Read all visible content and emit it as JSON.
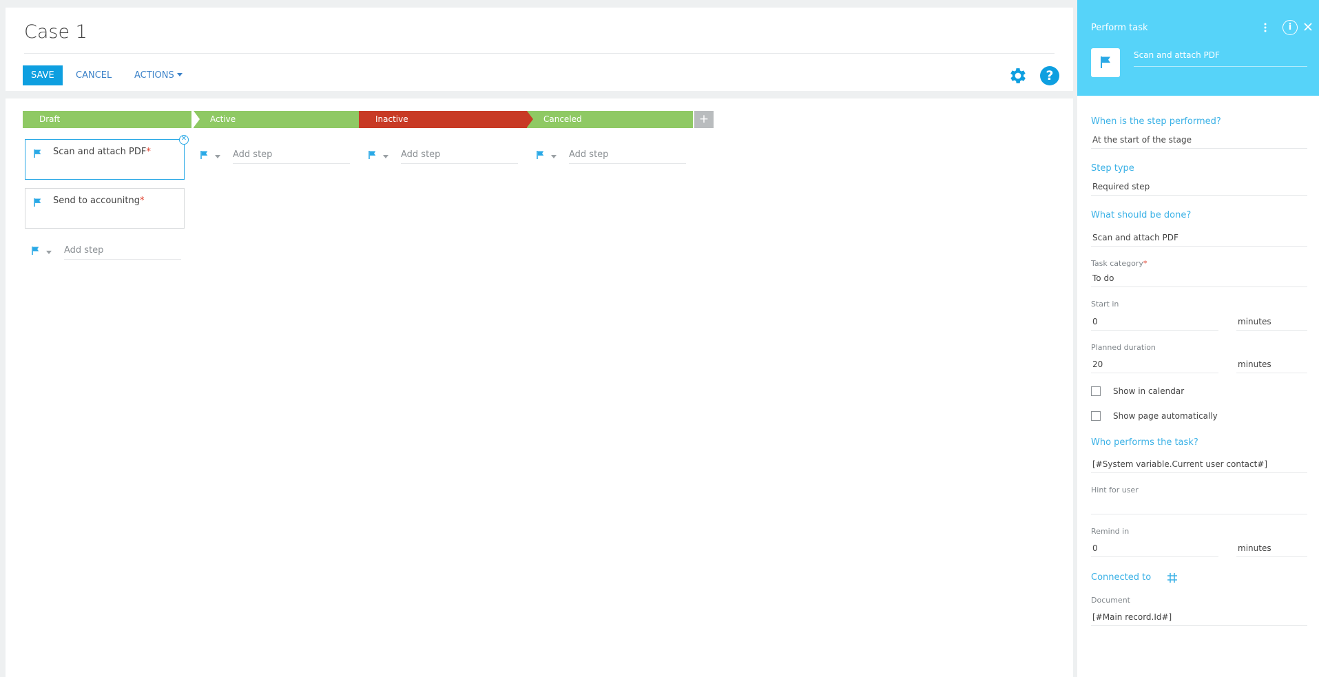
{
  "page": {
    "title": "Case 1",
    "save_label": "SAVE",
    "cancel_label": "CANCEL",
    "actions_label": "ACTIONS"
  },
  "stages": [
    {
      "label": "Draft",
      "color": "#8fc964"
    },
    {
      "label": "Active",
      "color": "#8fc964"
    },
    {
      "label": "Inactive",
      "color": "#c83a25"
    },
    {
      "label": "Canceled",
      "color": "#8fc964"
    }
  ],
  "add_stage_label": "+",
  "steps": [
    {
      "label": "Scan and attach PDF",
      "required_mark": "*"
    },
    {
      "label": "Send to accounitng",
      "required_mark": "*"
    }
  ],
  "add_step_placeholder": "Add step",
  "panel": {
    "title": "Perform task",
    "info_glyph": "i",
    "task_name": "Scan and attach PDF",
    "when_heading": "When is the step performed?",
    "when_value": "At the start of the stage",
    "step_type_heading": "Step type",
    "step_type_value": "Required step",
    "what_heading": "What should be done?",
    "what_value": "Scan and attach PDF",
    "task_category_label": "Task category",
    "task_category_required": "*",
    "task_category_value": "To do",
    "start_in_label": "Start in",
    "start_in_value": "0",
    "start_in_unit": "minutes",
    "planned_duration_label": "Planned duration",
    "planned_duration_value": "20",
    "planned_duration_unit": "minutes",
    "show_in_calendar_label": "Show in calendar",
    "show_in_calendar_checked": false,
    "show_page_auto_label": "Show page automatically",
    "show_page_auto_checked": false,
    "who_heading": "Who performs the task?",
    "who_value": "[#System variable.Current user contact#]",
    "hint_label": "Hint for user",
    "hint_value": "",
    "remind_in_label": "Remind in",
    "remind_in_value": "0",
    "remind_in_unit": "minutes",
    "connected_heading": "Connected to",
    "document_label": "Document",
    "document_value": "[#Main record.Id#]"
  },
  "colors": {
    "accent_blue": "#0e9fe0",
    "panel_header": "#56d3f9",
    "stage_green": "#8fc964",
    "stage_red": "#c83a25",
    "flag": "#2aa9e6",
    "required": "#e0412f"
  }
}
